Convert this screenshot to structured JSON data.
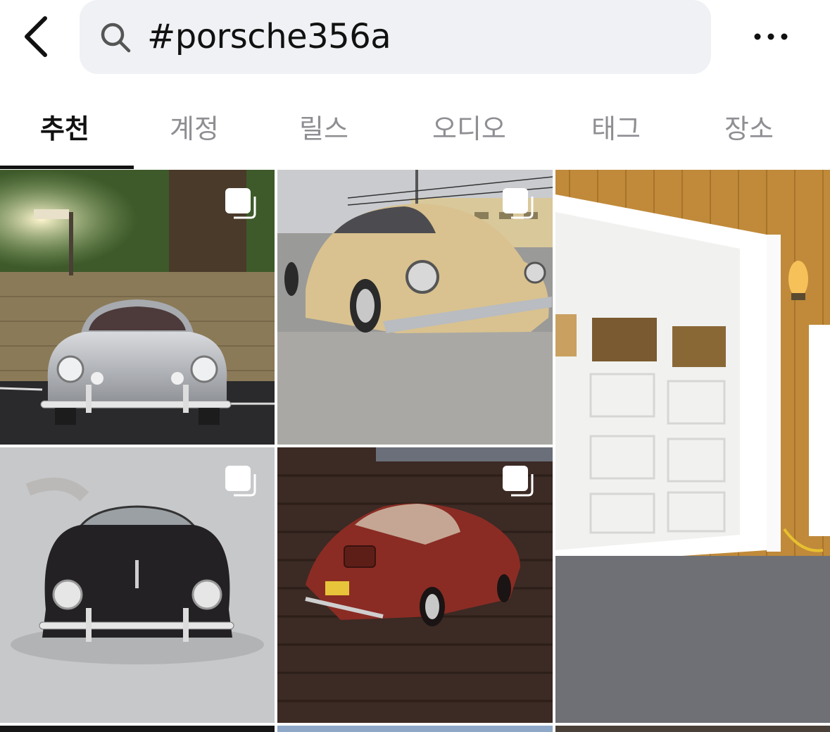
{
  "search": {
    "query": "#porsche356a"
  },
  "tabs": [
    {
      "label": "추천"
    },
    {
      "label": "계정"
    },
    {
      "label": "릴스"
    },
    {
      "label": "오디오"
    },
    {
      "label": "태그"
    },
    {
      "label": "장소"
    }
  ],
  "active_tab_index": 0,
  "icons": {
    "back": "chevron-left-icon",
    "search": "search-icon",
    "more": "more-horizontal-icon",
    "multi": "carousel-multi-icon"
  },
  "colors": {
    "search_bg": "#eff1f4",
    "active_tab": "#111111",
    "inactive_tab": "#8e8e93"
  }
}
